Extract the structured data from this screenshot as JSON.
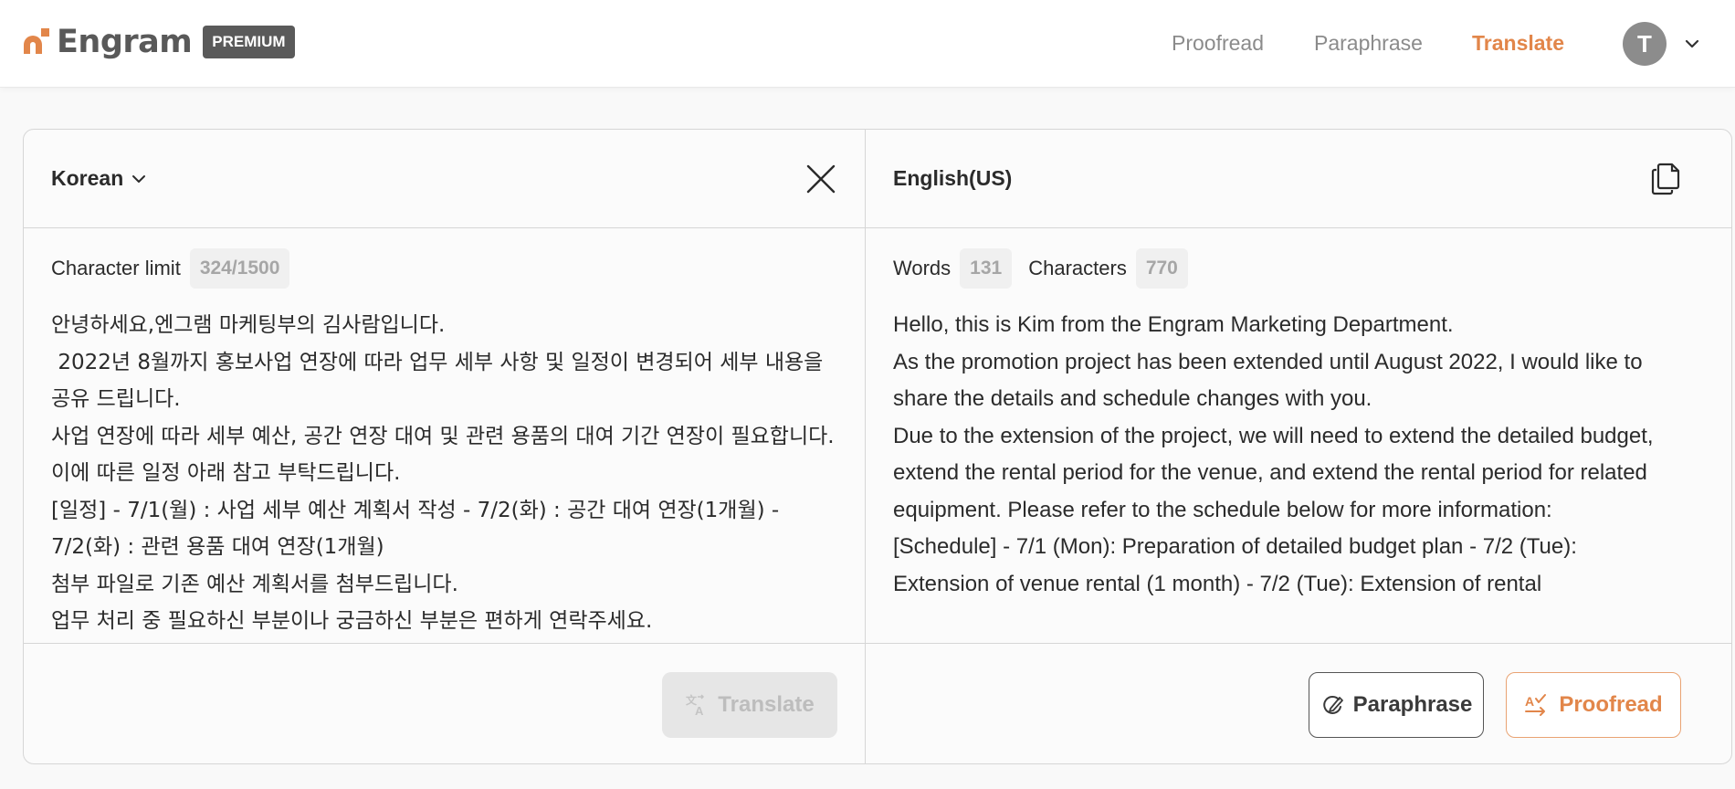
{
  "header": {
    "brand": "Engram",
    "badge": "PREMIUM",
    "nav": [
      {
        "label": "Proofread",
        "active": false
      },
      {
        "label": "Paraphrase",
        "active": false
      },
      {
        "label": "Translate",
        "active": true
      }
    ],
    "avatar_initial": "T",
    "icons": {
      "menu_toggle": "chevron-down-icon",
      "logo": "engram-logo-icon"
    }
  },
  "source": {
    "language": "Korean",
    "limit_label": "Character limit",
    "limit_value": "324/1500",
    "text": "안녕하세요,엔그램 마케팅부의 김사람입니다.\n 2022년 8월까지 홍보사업 연장에 따라 업무 세부 사항 및 일정이 변경되어 세부 내용을 공유 드립니다.\n사업 연장에 따라 세부 예산, 공간 연장 대여 및 관련 용품의 대여 기간 연장이 필요합니다. 이에 따른 일정 아래 참고 부탁드립니다.\n[일정] - 7/1(월) : 사업 세부 예산 계획서 작성 - 7/2(화) : 공간 대여 연장(1개월) - 7/2(화) : 관련 용품 대여 연장(1개월)\n첨부 파일로 기존 예산 계획서를 첨부드립니다.\n업무 처리 중 필요하신 부분이나 궁금하신 부분은 편하게 연락주세요.",
    "translate_button": "Translate"
  },
  "target": {
    "language": "English(US)",
    "words_label": "Words",
    "words_value": "131",
    "chars_label": "Characters",
    "chars_value": "770",
    "text": "Hello, this is Kim from the Engram Marketing Department.\nAs the promotion project has been extended until August 2022, I would like to share the details and schedule changes with you.\nDue to the extension of the project, we will need to extend the detailed budget, extend the rental period for the venue, and extend the rental period for related equipment. Please refer to the schedule below for more information:\n[Schedule] - 7/1 (Mon): Preparation of detailed budget plan - 7/2 (Tue): Extension of venue rental (1 month) - 7/2 (Tue): Extension of rental",
    "paraphrase_button": "Paraphrase",
    "proofread_button": "Proofread"
  },
  "colors": {
    "accent": "#e2864a",
    "badge_bg": "#5a5a5a",
    "nav_inactive": "#8b8b8b",
    "border": "#d6d6d6"
  }
}
